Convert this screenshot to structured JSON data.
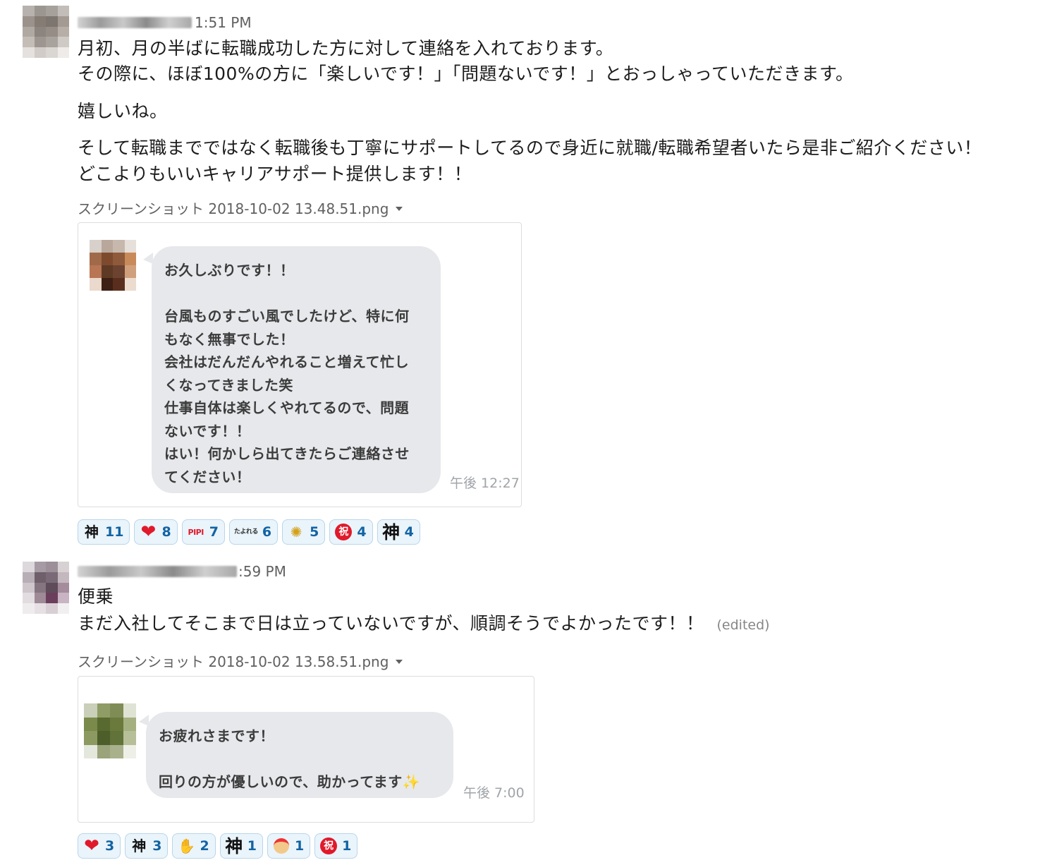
{
  "messages": [
    {
      "time": "1:51 PM",
      "lines": [
        "月初、月の半ばに転職成功した方に対して連絡を入れております。",
        "その際に、ほぼ100%の方に「楽しいです！」「問題ないです！」とおっしゃっていただきます。",
        "嬉しいね。",
        "そして転職までではなく転職後も丁寧にサポートしてるので身近に就職/転職希望者いたら是非ご紹介ください！",
        "どこよりもいいキャリアサポート提供します！！"
      ],
      "file_name": "スクリーンショット 2018-10-02 13.48.51.png",
      "preview": {
        "bubble_lines": [
          "お久しぶりです！！",
          "",
          "台風ものすごい風でしたけど、特に何",
          "もなく無事でした！",
          "会社はだんだんやれること増えて忙し",
          "くなってきました笑",
          "仕事自体は楽しくやれてるので、問題",
          "ないです！！",
          "はい！何かしら出てきたらご連絡させ",
          "てください！"
        ],
        "timestamp": "午後 12:27"
      },
      "reactions": [
        {
          "icon": "kami-text-icon",
          "glyph": "神",
          "count": "11"
        },
        {
          "icon": "heart-icon",
          "glyph": "❤",
          "count": "8"
        },
        {
          "icon": "pipi-stamp-icon",
          "glyph": "PIPI",
          "count": "7"
        },
        {
          "icon": "tayoreru-stamp-icon",
          "glyph": "たよれる",
          "count": "6"
        },
        {
          "icon": "party-popper-icon",
          "glyph": "✺",
          "count": "5"
        },
        {
          "icon": "iwai-badge-icon",
          "glyph": "祝",
          "count": "4"
        },
        {
          "icon": "kami-big-icon",
          "glyph": "神",
          "count": "4"
        }
      ]
    },
    {
      "time": ":59 PM",
      "lines": [
        "便乗",
        "まだ入社してそこまで日は立っていないですが、順調そうでよかったです！！"
      ],
      "edited": "(edited)",
      "file_name": "スクリーンショット 2018-10-02 13.58.51.png",
      "preview": {
        "bubble_lines": [
          "お疲れさまです！",
          "",
          "回りの方が優しいので、助かってます✨"
        ],
        "timestamp": "午後 7:00"
      },
      "reactions": [
        {
          "icon": "heart-icon",
          "glyph": "❤",
          "count": "3"
        },
        {
          "icon": "kami-text-icon",
          "glyph": "神",
          "count": "3"
        },
        {
          "icon": "clapping-hands-icon",
          "glyph": "✋",
          "count": "2"
        },
        {
          "icon": "kami-big-icon",
          "glyph": "神",
          "count": "1"
        },
        {
          "icon": "santa-icon",
          "glyph": "",
          "count": "1"
        },
        {
          "icon": "iwai-badge-icon",
          "glyph": "祝",
          "count": "1"
        }
      ]
    }
  ],
  "colors": {
    "time": "#616061",
    "reaction_bg": "#eaf4fb",
    "reaction_border": "#b9d6ea",
    "reaction_count": "#1264a3",
    "bubble": "#e6e8eb"
  }
}
